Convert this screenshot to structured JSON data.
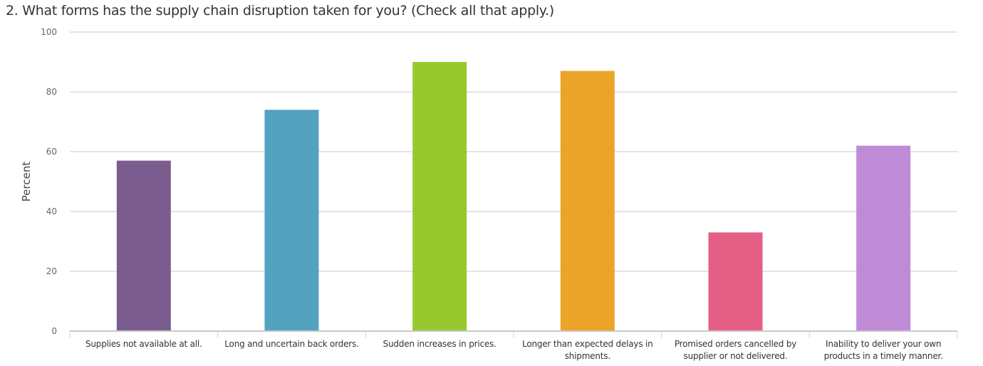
{
  "title": "2. What forms has the supply chain disruption taken for you? (Check all that apply.)",
  "chart_data": {
    "type": "bar",
    "title": "2. What forms has the supply chain disruption taken for you? (Check all that apply.)",
    "xlabel": "",
    "ylabel": "Percent",
    "ylim": [
      0,
      100
    ],
    "yticks": [
      "0",
      "20",
      "40",
      "60",
      "80",
      "100"
    ],
    "grid": true,
    "legend": "none",
    "categories": [
      "Supplies not available at all.",
      "Long and uncertain back orders.",
      "Sudden increases in prices.",
      "Longer than expected delays in shipments.",
      "Promised orders cancelled by supplier or not delivered.",
      "Inability to deliver your own products in a timely manner."
    ],
    "values": [
      57,
      74,
      90,
      87,
      33,
      62
    ],
    "colors": [
      "#7a5c8e",
      "#53a2c0",
      "#97c92f",
      "#eca428",
      "#e45e85",
      "#bf8bd7"
    ]
  }
}
